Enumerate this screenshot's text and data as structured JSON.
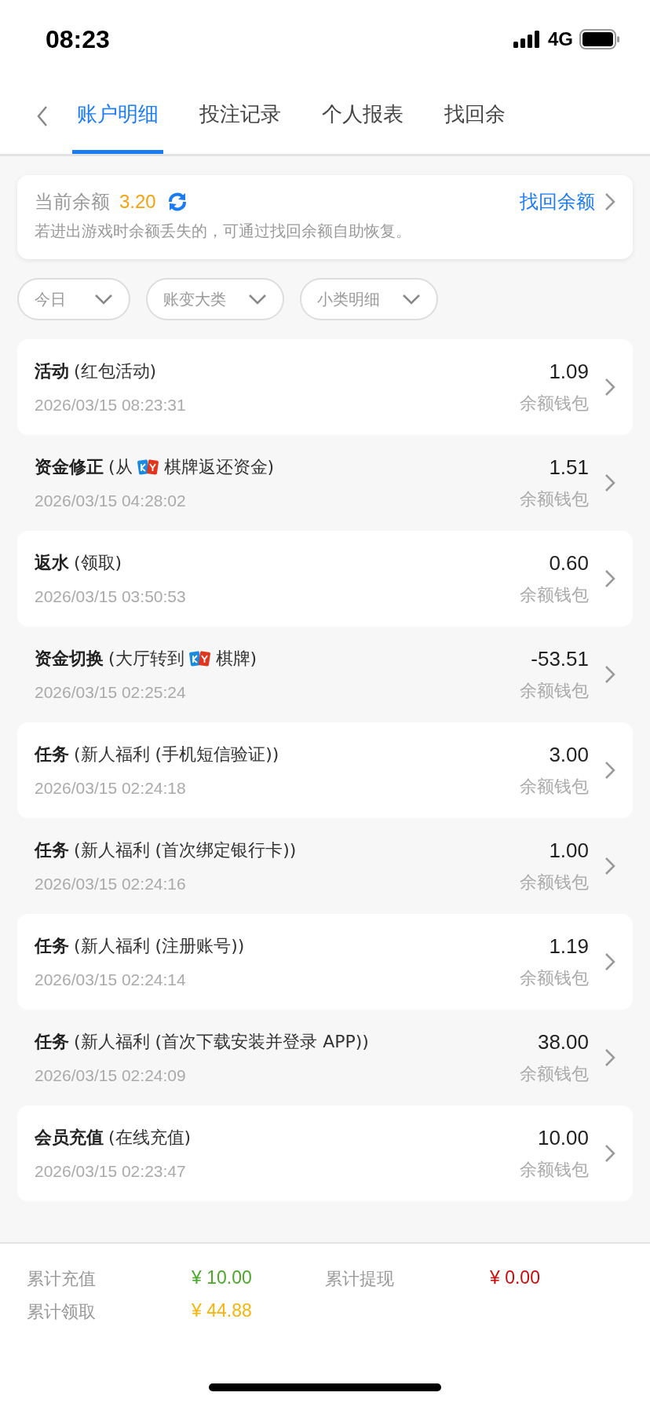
{
  "status_bar": {
    "time": "08:23",
    "network": "4G"
  },
  "tabs": [
    {
      "label": "账户明细",
      "selected": true
    },
    {
      "label": "投注记录",
      "selected": false
    },
    {
      "label": "个人报表",
      "selected": false
    },
    {
      "label": "找回余",
      "selected": false
    }
  ],
  "balance_card": {
    "label": "当前余额",
    "amount": "3.20",
    "link": "找回余额",
    "note": "若进出游戏时余额丢失的，可通过找回余额自助恢复。"
  },
  "filters": [
    {
      "label": "今日"
    },
    {
      "label": "账变大类"
    },
    {
      "label": "小类明细"
    }
  ],
  "entries": [
    {
      "category": "活动",
      "detail": [
        {
          "kind": "text",
          "text": "(红包活动)"
        }
      ],
      "time": "2026/03/15 08:23:31",
      "amount": "1.09",
      "wallet": "余额钱包"
    },
    {
      "category": "资金修正",
      "detail": [
        {
          "kind": "text",
          "text": "(从"
        },
        {
          "kind": "logo"
        },
        {
          "kind": "text",
          "text": "棋牌返还资金)"
        }
      ],
      "time": "2026/03/15 04:28:02",
      "amount": "1.51",
      "wallet": "余额钱包"
    },
    {
      "category": "返水",
      "detail": [
        {
          "kind": "text",
          "text": "(领取)"
        }
      ],
      "time": "2026/03/15 03:50:53",
      "amount": "0.60",
      "wallet": "余额钱包"
    },
    {
      "category": "资金切换",
      "detail": [
        {
          "kind": "text",
          "text": "(大厅转到"
        },
        {
          "kind": "logo"
        },
        {
          "kind": "text",
          "text": "棋牌)"
        }
      ],
      "time": "2026/03/15 02:25:24",
      "amount": "-53.51",
      "wallet": "余额钱包"
    },
    {
      "category": "任务",
      "detail": [
        {
          "kind": "text",
          "text": "(新人福利 (手机短信验证))"
        }
      ],
      "time": "2026/03/15 02:24:18",
      "amount": "3.00",
      "wallet": "余额钱包"
    },
    {
      "category": "任务",
      "detail": [
        {
          "kind": "text",
          "text": "(新人福利 (首次绑定银行卡))"
        }
      ],
      "time": "2026/03/15 02:24:16",
      "amount": "1.00",
      "wallet": "余额钱包"
    },
    {
      "category": "任务",
      "detail": [
        {
          "kind": "text",
          "text": "(新人福利 (注册账号))"
        }
      ],
      "time": "2026/03/15 02:24:14",
      "amount": "1.19",
      "wallet": "余额钱包"
    },
    {
      "category": "任务",
      "detail": [
        {
          "kind": "text",
          "text": "(新人福利 (首次下载安装并登录 APP))"
        }
      ],
      "time": "2026/03/15 02:24:09",
      "amount": "38.00",
      "wallet": "余额钱包"
    },
    {
      "category": "会员充值",
      "detail": [
        {
          "kind": "text",
          "text": "(在线充值)"
        }
      ],
      "time": "2026/03/15 02:23:47",
      "amount": "10.00",
      "wallet": "余额钱包"
    }
  ],
  "summary": [
    {
      "label": "累计充值",
      "value": "¥ 10.00",
      "color": "#4aa829"
    },
    {
      "label": "累计提现",
      "value": "¥ 0.00",
      "color": "#cc0a0a"
    },
    {
      "label": "累计领取",
      "value": "¥ 44.88",
      "color": "#f8b40c"
    }
  ]
}
